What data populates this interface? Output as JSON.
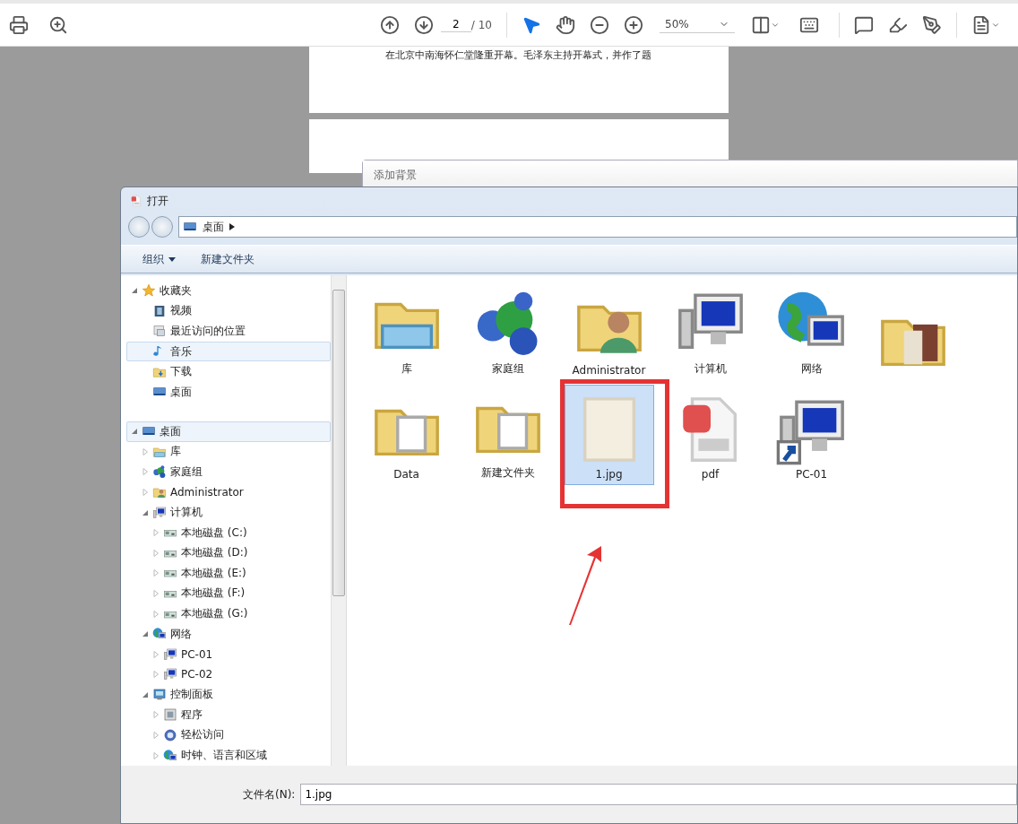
{
  "toolbar": {
    "page": {
      "value": "2",
      "total": "/ 10"
    },
    "zoom": {
      "value": "50%"
    },
    "tools": [
      {
        "kind": "select",
        "selected": true
      },
      {
        "kind": "hand",
        "selected": false
      }
    ]
  },
  "document": {
    "line": "在北京中南海怀仁堂隆重开幕。毛泽东主持开幕式，并作了题"
  },
  "background_dialog": {
    "title": "添加背景"
  },
  "open_dialog": {
    "title": "打开",
    "address": "桌面",
    "commands": [
      {
        "label": "组织",
        "menu": true
      },
      {
        "label": "新建文件夹",
        "menu": false
      }
    ],
    "tree": [
      {
        "label": "收藏夹",
        "kind": "star",
        "expanded": true,
        "selected": false,
        "children": [
          {
            "label": "视频",
            "kind": "video",
            "selected": false
          },
          {
            "label": "最近访问的位置",
            "kind": "recent",
            "selected": false
          },
          {
            "label": "音乐",
            "kind": "music",
            "selected": true
          },
          {
            "label": "下载",
            "kind": "download",
            "selected": false
          },
          {
            "label": "桌面",
            "kind": "desktop",
            "selected": false
          }
        ]
      },
      {
        "label": "桌面",
        "kind": "desktop",
        "expanded": true,
        "selected": true,
        "children": [
          {
            "label": "库",
            "kind": "library",
            "expanded": false,
            "selected": false
          },
          {
            "label": "家庭组",
            "kind": "homegroup",
            "expanded": false,
            "selected": false
          },
          {
            "label": "Administrator",
            "kind": "user",
            "expanded": false,
            "selected": false
          },
          {
            "label": "计算机",
            "kind": "computer",
            "expanded": true,
            "selected": false,
            "children": [
              {
                "label": "本地磁盘 (C:)",
                "kind": "drive",
                "expanded": false,
                "selected": false
              },
              {
                "label": "本地磁盘 (D:)",
                "kind": "drive",
                "expanded": false,
                "selected": false
              },
              {
                "label": "本地磁盘 (E:)",
                "kind": "drive",
                "expanded": false,
                "selected": false
              },
              {
                "label": "本地磁盘 (F:)",
                "kind": "drive",
                "expanded": false,
                "selected": false
              },
              {
                "label": "本地磁盘 (G:)",
                "kind": "drive",
                "expanded": false,
                "selected": false
              }
            ]
          },
          {
            "label": "网络",
            "kind": "network",
            "expanded": true,
            "selected": false,
            "children": [
              {
                "label": "PC-01",
                "kind": "computer",
                "expanded": false,
                "selected": false
              },
              {
                "label": "PC-02",
                "kind": "computer",
                "expanded": false,
                "selected": false
              }
            ]
          },
          {
            "label": "控制面板",
            "kind": "panel",
            "expanded": true,
            "selected": false,
            "children": [
              {
                "label": "程序",
                "kind": "program",
                "expanded": false,
                "selected": false
              },
              {
                "label": "轻松访问",
                "kind": "access",
                "expanded": false,
                "selected": false
              },
              {
                "label": "时钟、语言和区域",
                "kind": "network",
                "expanded": false,
                "selected": false
              }
            ]
          }
        ]
      }
    ],
    "files": [
      {
        "label": "库",
        "kind": "library",
        "selected": false,
        "annotated": false
      },
      {
        "label": "家庭组",
        "kind": "homegroup",
        "selected": false,
        "annotated": false
      },
      {
        "label": "Administrator",
        "kind": "user",
        "selected": false,
        "annotated": false
      },
      {
        "label": "计算机",
        "kind": "computer",
        "selected": false,
        "annotated": false
      },
      {
        "label": "网络",
        "kind": "network",
        "selected": false,
        "annotated": false
      },
      {
        "kind": "photos",
        "selected": false,
        "annotated": false
      },
      {
        "label": "Data",
        "kind": "folder",
        "selected": false,
        "annotated": false
      },
      {
        "label": "新建文件夹",
        "kind": "folder",
        "selected": false,
        "annotated": false
      },
      {
        "label": "1.jpg",
        "kind": "image",
        "selected": true,
        "annotated": true
      },
      {
        "label": "pdf",
        "kind": "pdf",
        "selected": false,
        "annotated": false
      },
      {
        "label": "PC-01",
        "kind": "shortcut",
        "selected": false,
        "annotated": false
      }
    ],
    "filename": {
      "label": "文件名(N):",
      "value": "1.jpg"
    }
  }
}
